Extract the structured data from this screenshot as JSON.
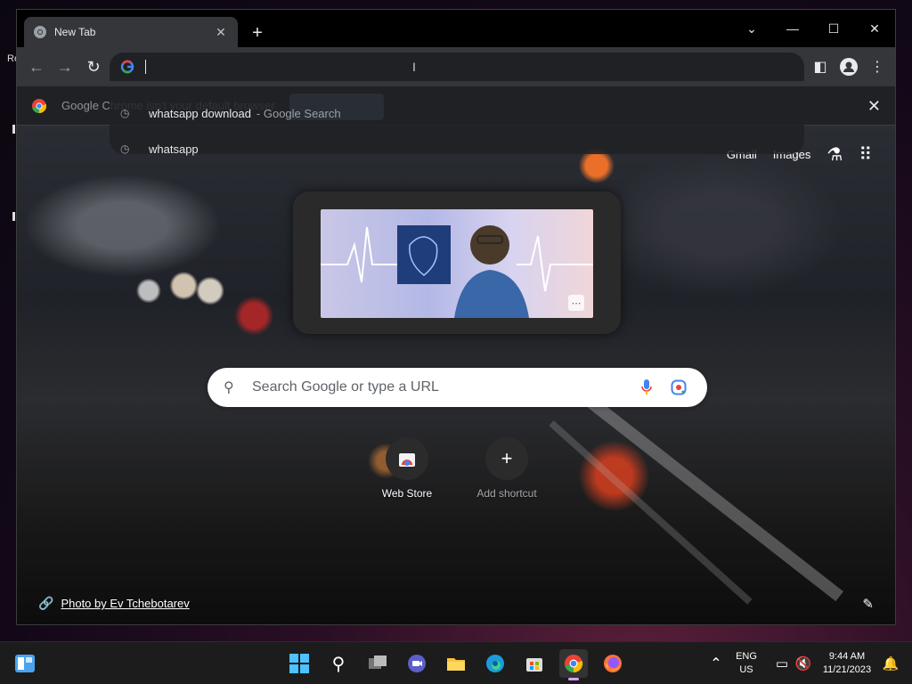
{
  "browser": {
    "tab_title": "New Tab",
    "omnibox_value": "",
    "infobar_text": "Google Chrome isn't your default browser",
    "infobar_button": "Set as default"
  },
  "omnibox_suggestions": [
    {
      "text": "whatsapp download",
      "sub": "- Google Search"
    },
    {
      "text": "whatsapp",
      "sub": ""
    }
  ],
  "ntp": {
    "top_links": [
      "Gmail",
      "Images"
    ],
    "search_placeholder": "Search Google or type a URL",
    "shortcuts": [
      {
        "label": "Web Store"
      },
      {
        "label": "Add shortcut"
      }
    ],
    "photo_credit": "Photo by Ev Tchebotarev"
  },
  "taskbar": {
    "lang_line1": "ENG",
    "lang_line2": "US",
    "time": "9:44 AM",
    "date": "11/21/2023",
    "pinned_icons": [
      "start-icon",
      "search-icon",
      "task-view-icon",
      "meet-icon",
      "file-explorer-icon",
      "edge-icon",
      "store-icon",
      "chrome-icon",
      "firefox-icon"
    ]
  },
  "desktop": {
    "fragment_text": "Re"
  },
  "colors": {
    "accent_blue": "#8ab4f8",
    "taskbar_bg": "#1c1c1c",
    "toolbar_bg": "#35363a"
  }
}
